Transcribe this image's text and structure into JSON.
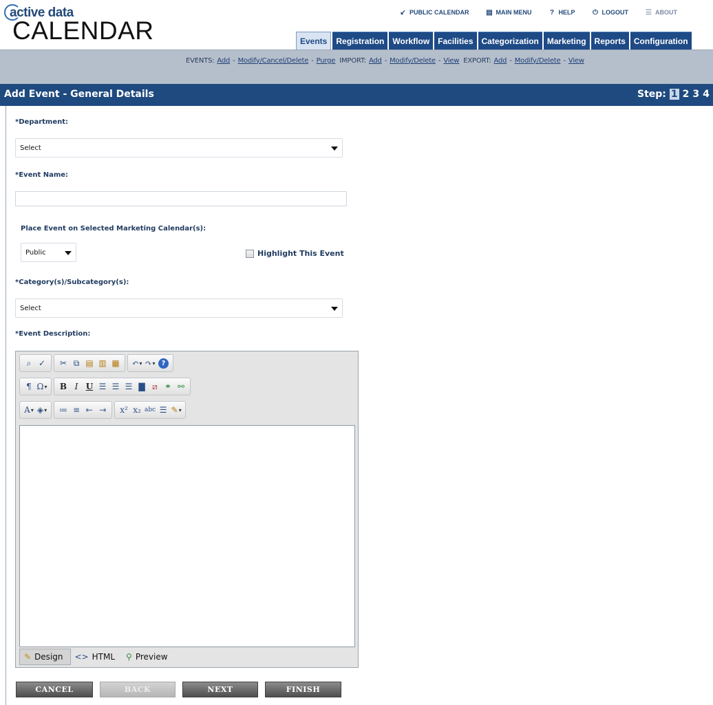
{
  "logo": {
    "top": "active data",
    "main": "CALENDAR"
  },
  "toplinks": [
    {
      "label": "PUBLIC CALENDAR",
      "icon": "arrow-icon"
    },
    {
      "label": "MAIN MENU",
      "icon": "menu-icon"
    },
    {
      "label": "HELP",
      "icon": "help-icon"
    },
    {
      "label": "LOGOUT",
      "icon": "logout-icon"
    },
    {
      "label": "ABOUT",
      "icon": "about-icon"
    }
  ],
  "tabs": [
    "Events",
    "Registration",
    "Workflow",
    "Facilities",
    "Categorization",
    "Marketing",
    "Reports",
    "Configuration"
  ],
  "subnav": {
    "events_label": "EVENTS:",
    "events": [
      "Add",
      "Modify/Cancel/Delete",
      "Purge"
    ],
    "import_label": "IMPORT:",
    "import": [
      "Add",
      "Modify/Delete",
      "View"
    ],
    "export_label": "EXPORT:",
    "export": [
      "Add",
      "Modify/Delete",
      "View"
    ],
    "separator": "-"
  },
  "titlebar": {
    "title": "Add Event - General Details",
    "step_label": "Step:",
    "steps": [
      "1",
      "2",
      "3",
      "4"
    ],
    "current_step": "1"
  },
  "form": {
    "department_label": "*Department:",
    "department_value": "Select",
    "event_name_label": "*Event Name:",
    "event_name_value": "",
    "marketing_label": "Place Event on Selected Marketing Calendar(s):",
    "marketing_value": "Public",
    "highlight_label": "Highlight This Event",
    "category_label": "*Category(s)/Subcategory(s):",
    "category_value": "Select",
    "description_label": "*Event Description:"
  },
  "editor": {
    "modes": [
      "Design",
      "HTML",
      "Preview"
    ],
    "active_mode": "Design"
  },
  "buttons": {
    "cancel": "CANCEL",
    "back": "BACK",
    "next": "NEXT",
    "finish": "FINISH"
  }
}
